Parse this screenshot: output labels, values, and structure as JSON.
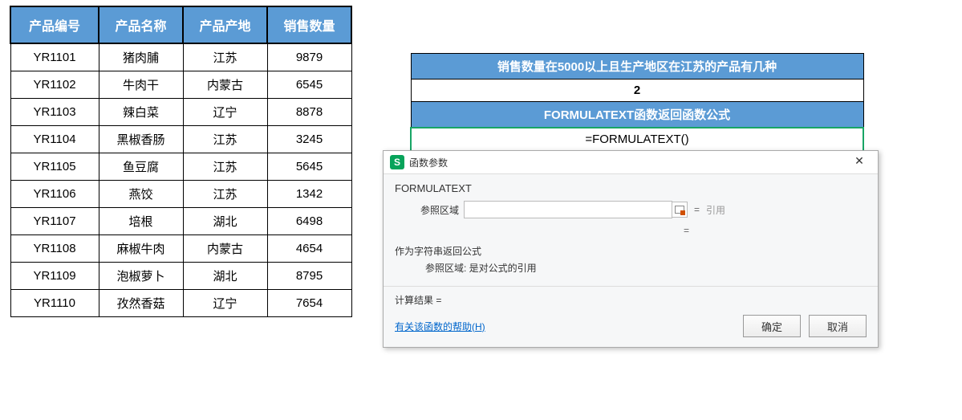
{
  "table": {
    "headers": [
      "产品编号",
      "产品名称",
      "产品产地",
      "销售数量"
    ],
    "rows": [
      [
        "YR1101",
        "猪肉脯",
        "江苏",
        "9879"
      ],
      [
        "YR1102",
        "牛肉干",
        "内蒙古",
        "6545"
      ],
      [
        "YR1103",
        "辣白菜",
        "辽宁",
        "8878"
      ],
      [
        "YR1104",
        "黑椒香肠",
        "江苏",
        "3245"
      ],
      [
        "YR1105",
        "鱼豆腐",
        "江苏",
        "5645"
      ],
      [
        "YR1106",
        "燕饺",
        "江苏",
        "1342"
      ],
      [
        "YR1107",
        "培根",
        "湖北",
        "6498"
      ],
      [
        "YR1108",
        "麻椒牛肉",
        "内蒙古",
        "4654"
      ],
      [
        "YR1109",
        "泡椒萝卜",
        "湖北",
        "8795"
      ],
      [
        "YR1110",
        "孜然香菇",
        "辽宁",
        "7654"
      ]
    ]
  },
  "summary": {
    "title1": "销售数量在5000以上且生产地区在江苏的产品有几种",
    "value1": "2",
    "title2": "FORMULATEXT函数返回函数公式",
    "value2": "=FORMULATEXT()"
  },
  "dialog": {
    "logo_char": "S",
    "title": "函数参数",
    "close_glyph": "✕",
    "func_name": "FORMULATEXT",
    "param_label": "参照区域",
    "param_value": "",
    "eq": "=",
    "hint": "引用",
    "result_eq": "=",
    "desc": "作为字符串返回公式",
    "desc_sub": "参照区域:  是对公式的引用",
    "calc_label": "计算结果 =",
    "help": "有关该函数的帮助(H)",
    "ok": "确定",
    "cancel": "取消"
  }
}
